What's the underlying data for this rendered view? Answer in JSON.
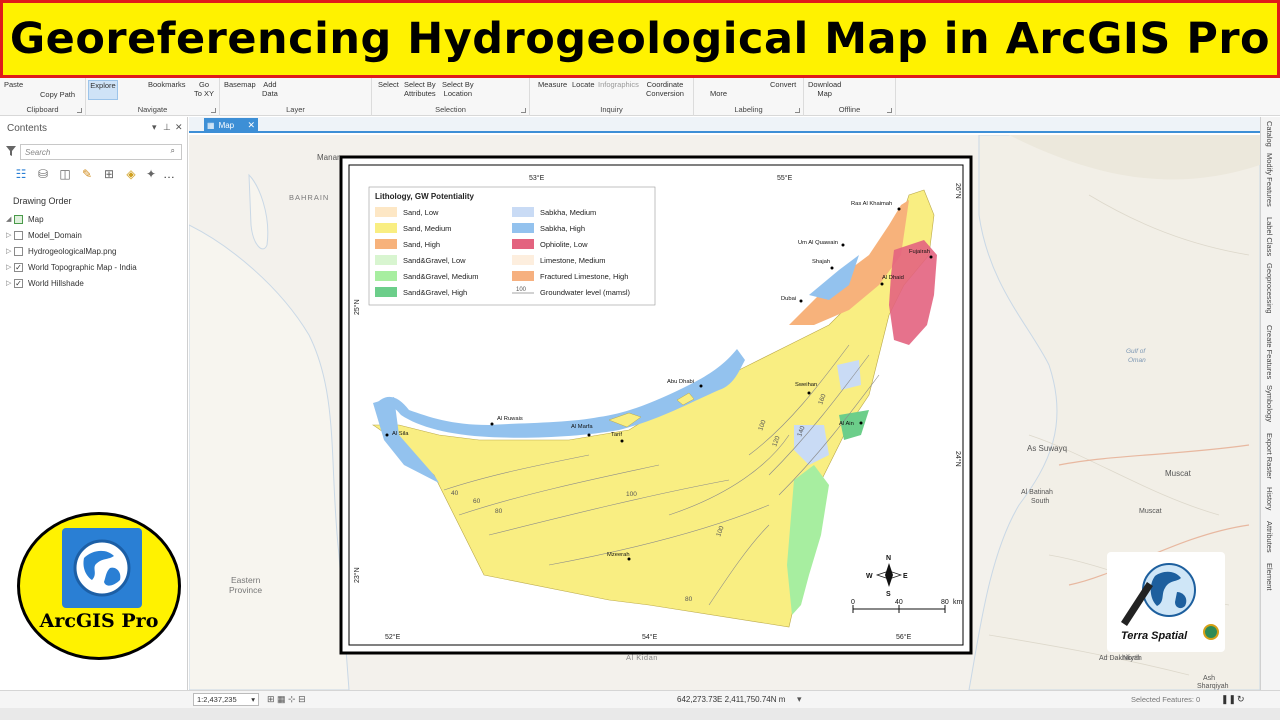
{
  "banner": {
    "title": "Georeferencing Hydrogeological Map in ArcGIS Pro"
  },
  "ribbon": {
    "clipboard": {
      "paste": "Paste",
      "copy_path": "Copy Path",
      "label": "Clipboard"
    },
    "navigate": {
      "explore": "Explore",
      "bookmarks": "Bookmarks",
      "go_to_xy": "Go\nTo XY",
      "label": "Navigate"
    },
    "layer": {
      "basemap": "Basemap",
      "add_data": "Add\nData",
      "label": "Layer"
    },
    "selection": {
      "select": "Select",
      "by_attributes": "Select By\nAttributes",
      "by_location": "Select By\nLocation",
      "label": "Selection"
    },
    "inquiry": {
      "measure": "Measure",
      "locate": "Locate",
      "infographics": "Infographics",
      "coordinate_conversion": "Coordinate\nConversion",
      "label": "Inquiry"
    },
    "labeling": {
      "more": "More",
      "convert": "Convert",
      "label": "Labeling"
    },
    "offline": {
      "download_map": "Download\nMap",
      "label": "Offline"
    }
  },
  "contents": {
    "title": "Contents",
    "search_placeholder": "Search",
    "drawing_order": "Drawing Order",
    "layers": [
      {
        "name": "Map",
        "checked": true
      },
      {
        "name": "Model_Domain",
        "checked": false
      },
      {
        "name": "HydrogeologicalMap.png",
        "checked": false
      },
      {
        "name": "World Topographic Map - India",
        "checked": true
      },
      {
        "name": "World Hillshade",
        "checked": true
      }
    ]
  },
  "map_tab": {
    "label": "Map"
  },
  "basemap_labels": {
    "manama": "Manama",
    "bahrain": "BAHRAIN",
    "eastern_province": "Eastern\nProvince",
    "gulf_of_oman": "Gulf of\nOman",
    "as_suwayq": "As Suwayq",
    "muscat": "Muscat",
    "al_batinah_south": "Al Batinah\nSouth",
    "muscat_region": "Muscat",
    "al_kidan": "Al Kidan",
    "ad_dakhiliyah": "Ad Dakhiliyah",
    "ash_sharqiyah": "Ash\nSharqiyah",
    "north": "North"
  },
  "hydro_map": {
    "legend_title": "Lithology, GW Potentiality",
    "legend": [
      {
        "label": "Sand, Low",
        "color": "#fde7c5"
      },
      {
        "label": "Sand, Medium",
        "color": "#f9ee82"
      },
      {
        "label": "Sand, High",
        "color": "#f7b27b"
      },
      {
        "label": "Sand&Gravel, Low",
        "color": "#d8f5d0"
      },
      {
        "label": "Sand&Gravel, Medium",
        "color": "#a7eea0"
      },
      {
        "label": "Sand&Gravel, High",
        "color": "#6cce8a"
      },
      {
        "label": "Sabkha, Medium",
        "color": "#c9dbf5"
      },
      {
        "label": "Sabkha, High",
        "color": "#93c2ee"
      },
      {
        "label": "Ophiolite, Low",
        "color": "#e3637f"
      },
      {
        "label": "Limestone, Medium",
        "color": "#fdeede"
      },
      {
        "label": "Fractured Limestone, High",
        "color": "#f6b07f"
      },
      {
        "label": "Groundwater level (mamsl)",
        "color": "#888888"
      }
    ],
    "gw_sample": "100",
    "lon_top": [
      "53°E",
      "55°E"
    ],
    "lon_bottom": [
      "52°E",
      "54°E",
      "56°E"
    ],
    "lat_right": [
      "26°N",
      "24°N"
    ],
    "lat_left": [
      "25°N",
      "23°N"
    ],
    "cities": [
      "Ras Al Khaimah",
      "Um Al Quawain",
      "Shajah",
      "Fujairah",
      "Al Dhaid",
      "Dubai",
      "Abu Dhabi",
      "Sweihan",
      "Al Ain",
      "Al Ruwais",
      "Al Marfa",
      "Al Sila",
      "Tarif",
      "Mzeerah"
    ],
    "contours": [
      "40",
      "60",
      "80",
      "100",
      "100",
      "120",
      "140",
      "100",
      "80",
      "160"
    ],
    "scale": {
      "zero": "0",
      "mid": "40",
      "end": "80",
      "unit": "km"
    },
    "north_arrow": {
      "n": "N",
      "s": "S",
      "e": "E",
      "w": "W"
    }
  },
  "logos": {
    "arcgis": "ArcGIS Pro",
    "terra": "Terra Spatial"
  },
  "sidepanel": [
    "Catalog",
    "Modify Features",
    "Label Class",
    "Geoprocessing",
    "Create Features",
    "Symbology",
    "Export Raster",
    "History",
    "Attributes",
    "Element"
  ],
  "status": {
    "scale": "1:2,437,235",
    "coordinates": "642,273.73E 2,411,750.74N m",
    "selected_features": "Selected Features: 0"
  }
}
